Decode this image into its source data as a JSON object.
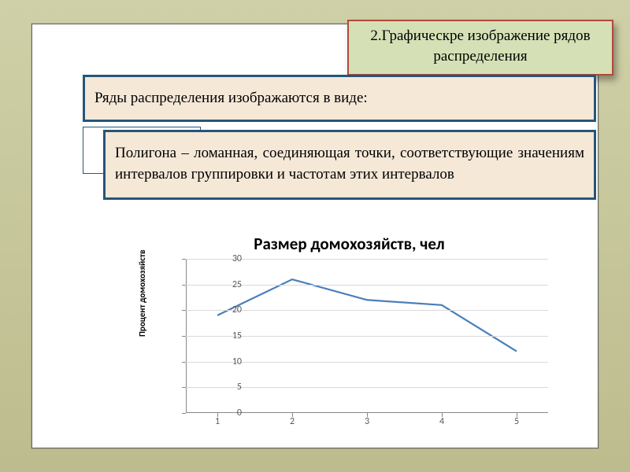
{
  "title": "2.Графическре изображение рядов распределения",
  "intro": "Ряды распределения изображаются в виде:",
  "definition": "Полигона – ломанная, соединяющая точки, соответствующие значениям интервалов группировки и частотам этих интервалов",
  "chart_data": {
    "type": "line",
    "title": "Размер домохозяйств, чел",
    "ylabel": "Процент домохозяйств",
    "xlabel": "",
    "categories": [
      "1",
      "2",
      "3",
      "4",
      "5"
    ],
    "values": [
      19,
      26,
      22,
      21,
      12
    ],
    "ylim": [
      0,
      30
    ],
    "yticks": [
      0,
      5,
      10,
      15,
      20,
      25,
      30
    ],
    "grid": true,
    "line_color": "#4a7ebb"
  }
}
